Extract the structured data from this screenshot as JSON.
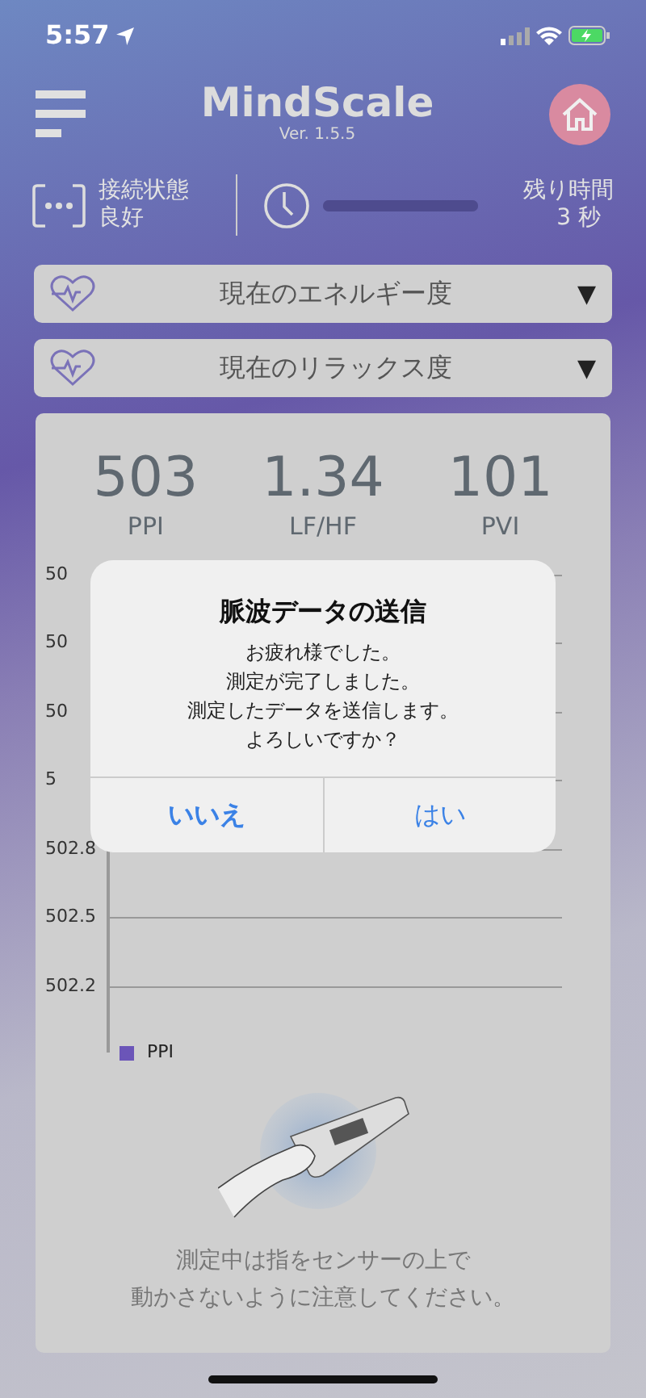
{
  "status_bar": {
    "time": "5:57"
  },
  "header": {
    "title": "MindScale",
    "version": "Ver. 1.5.5"
  },
  "connection": {
    "label": "接続状態",
    "value": "良好"
  },
  "remaining": {
    "label": "残り時間",
    "value": "3 秒",
    "level": 1
  },
  "dropdowns": [
    {
      "label": "現在のエネルギー度",
      "arrow": "▼"
    },
    {
      "label": "現在のリラックス度",
      "arrow": "▼"
    }
  ],
  "metrics": [
    {
      "value": "503",
      "label": "PPI"
    },
    {
      "value": "1.34",
      "label": "LF/HF"
    },
    {
      "value": "101",
      "label": "PVI"
    }
  ],
  "chart": {
    "yticks": [
      "50",
      "50",
      "50",
      "5",
      "502.8",
      "502.5",
      "502.2"
    ],
    "legend": "PPI"
  },
  "instruction": [
    "測定中は指をセンサーの上で",
    "動かさないように注意してください。"
  ],
  "dialog": {
    "title": "脈波データの送信",
    "message": [
      "お疲れ様でした。",
      "測定が完了しました。",
      "測定したデータを送信します。",
      "よろしいですか？"
    ],
    "buttons": [
      {
        "label": "いいえ",
        "kind": "cancel"
      },
      {
        "label": "はい",
        "kind": "default"
      }
    ]
  }
}
